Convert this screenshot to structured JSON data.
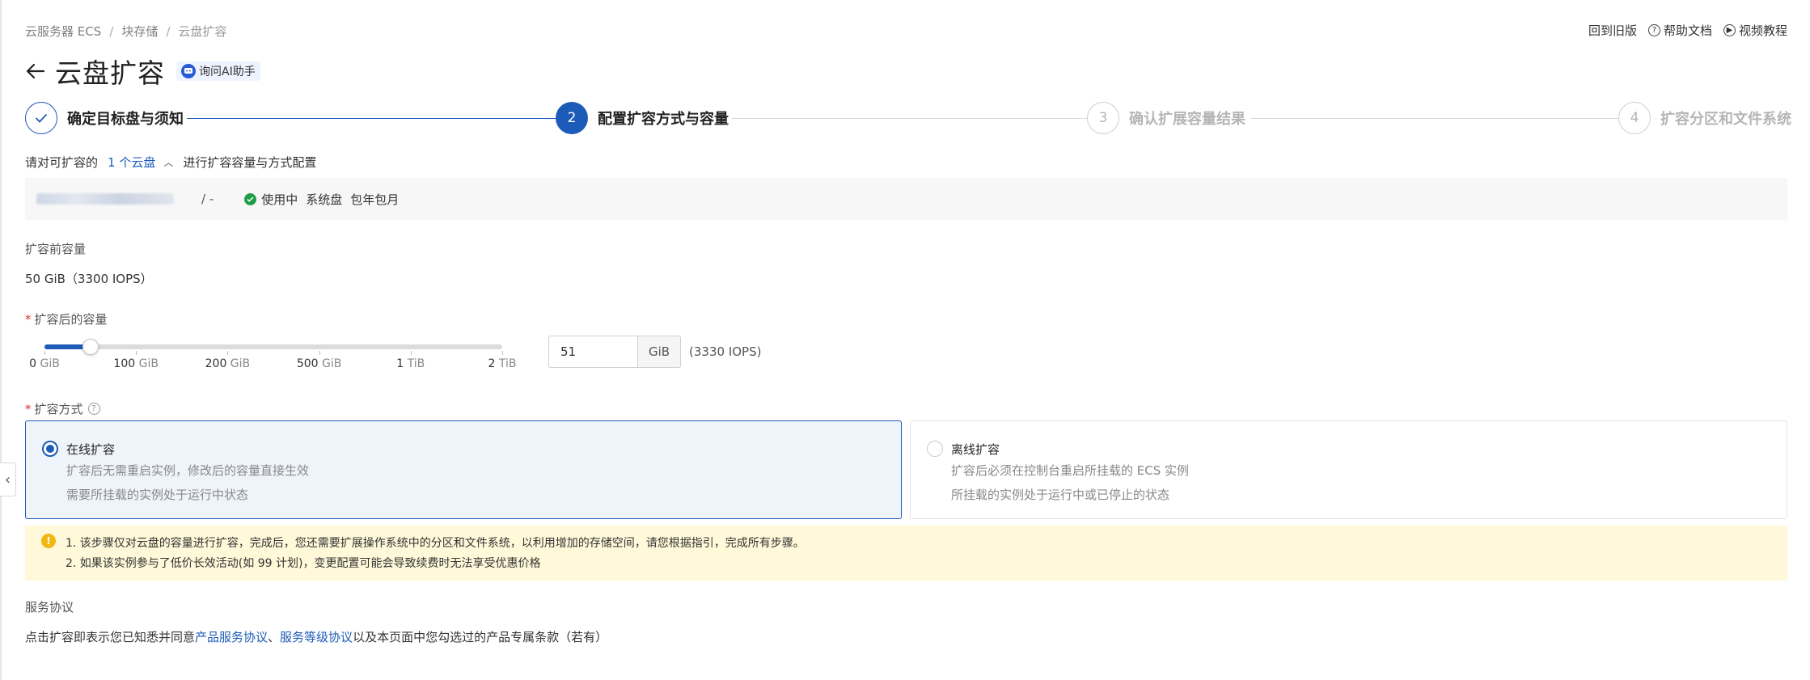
{
  "breadcrumb": [
    "云服务器 ECS",
    "块存储",
    "云盘扩容"
  ],
  "top_links": {
    "old_version": "回到旧版",
    "help_docs": "帮助文档",
    "video_tutorial": "视频教程"
  },
  "page": {
    "title": "云盘扩容",
    "ai_button": "询问AI助手"
  },
  "steps": [
    {
      "index": "1",
      "label": "确定目标盘与须知",
      "state": "done"
    },
    {
      "index": "2",
      "label": "配置扩容方式与容量",
      "state": "active"
    },
    {
      "index": "3",
      "label": "确认扩展容量结果",
      "state": "todo"
    },
    {
      "index": "4",
      "label": "扩容分区和文件系统",
      "state": "todo"
    }
  ],
  "disk_intro": {
    "prefix": "请对可扩容的",
    "link": "1 个云盘",
    "suffix": "进行扩容容量与方式配置"
  },
  "disk": {
    "separator": "/ -",
    "status": "使用中",
    "type": "系统盘",
    "billing": "包年包月"
  },
  "before": {
    "label": "扩容前容量",
    "value": "50 GiB（3300 IOPS）"
  },
  "after": {
    "label": "扩容后的容量",
    "slider_ticks": [
      {
        "num": "0",
        "unit": "GiB"
      },
      {
        "num": "100",
        "unit": "GiB"
      },
      {
        "num": "200",
        "unit": "GiB"
      },
      {
        "num": "500",
        "unit": "GiB"
      },
      {
        "num": "1",
        "unit": "TiB"
      },
      {
        "num": "2",
        "unit": "TiB"
      }
    ],
    "slider_level_fraction": 0.1,
    "input_value": "51",
    "unit": "GiB",
    "iops": "(3330 IOPS)"
  },
  "method": {
    "label": "扩容方式",
    "options": [
      {
        "title": "在线扩容",
        "line1": "扩容后无需重启实例，修改后的容量直接生效",
        "line2": "需要所挂载的实例处于运行中状态",
        "selected": true
      },
      {
        "title": "离线扩容",
        "line1": "扩容后必须在控制台重启所挂载的 ECS 实例",
        "line2": "所挂载的实例处于运行中或已停止的状态",
        "selected": false
      }
    ]
  },
  "notice": {
    "line1": "1. 该步骤仅对云盘的容量进行扩容，完成后，您还需要扩展操作系统中的分区和文件系统，以利用增加的存储空间，请您根据指引，完成所有步骤。",
    "line2": "2. 如果该实例参与了低价长效活动(如 99 计划)，变更配置可能会导致续费时无法享受优惠价格"
  },
  "agreement": {
    "label": "服务协议",
    "prefix": "点击扩容即表示您已知悉并同意",
    "link1": "产品服务协议",
    "sep": "、",
    "link2": "服务等级协议",
    "suffix": "以及本页面中您勾选过的产品专属条款（若有）"
  },
  "colors": {
    "primary": "#1d5bb8",
    "success": "#1e9e48",
    "warning": "#f2b811",
    "notice_bg": "#fff8d9"
  }
}
